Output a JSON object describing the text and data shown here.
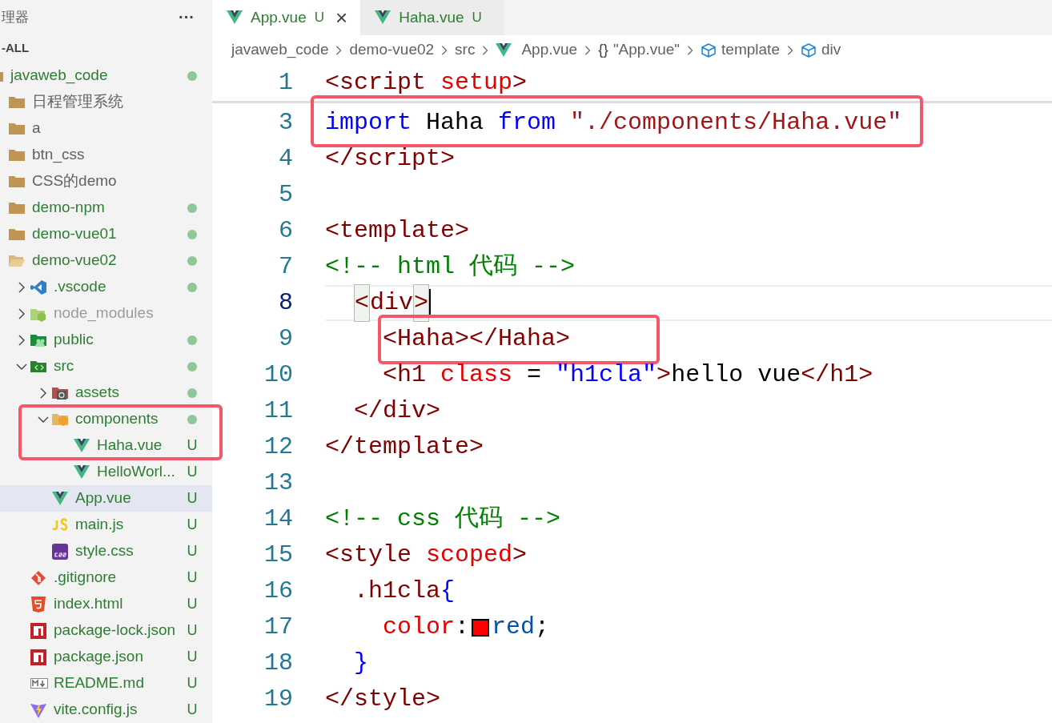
{
  "sidebar": {
    "title": "理器",
    "more": "···",
    "section": "-ALL",
    "tree": [
      {
        "label": "javaweb_code",
        "kind": "folder",
        "changed": true,
        "dimmed": false,
        "dot": true,
        "selected": false,
        "boxed": false,
        "children": [
          {
            "label": "日程管理系统",
            "kind": "folder",
            "changed": false,
            "dimmed": false,
            "dot": false,
            "selected": false,
            "boxed": false
          },
          {
            "label": "a",
            "kind": "folder",
            "changed": false,
            "dimmed": false,
            "dot": false,
            "selected": false,
            "boxed": false
          },
          {
            "label": "btn_css",
            "kind": "folder",
            "changed": false,
            "dimmed": false,
            "dot": false,
            "selected": false,
            "boxed": false
          },
          {
            "label": "CSS的demo",
            "kind": "folder",
            "changed": false,
            "dimmed": false,
            "dot": false,
            "selected": false,
            "boxed": false
          },
          {
            "label": "demo-npm",
            "kind": "folder",
            "changed": true,
            "dimmed": false,
            "dot": true,
            "selected": false,
            "boxed": false
          },
          {
            "label": "demo-vue01",
            "kind": "folder",
            "changed": true,
            "dimmed": false,
            "dot": true,
            "selected": false,
            "boxed": false
          },
          {
            "label": "demo-vue02",
            "kind": "folder-open",
            "changed": true,
            "dimmed": false,
            "dot": true,
            "selected": false,
            "boxed": false,
            "children": [
              {
                "label": ".vscode",
                "kind": "vscode",
                "changed": true,
                "dimmed": false,
                "dot": true,
                "expanded": false,
                "selected": false,
                "boxed": false
              },
              {
                "label": "node_modules",
                "kind": "node",
                "changed": false,
                "dimmed": true,
                "dot": false,
                "expanded": false,
                "selected": false,
                "boxed": false
              },
              {
                "label": "public",
                "kind": "public",
                "changed": true,
                "dimmed": false,
                "dot": true,
                "expanded": false,
                "selected": false,
                "boxed": false
              },
              {
                "label": "src",
                "kind": "src",
                "changed": true,
                "dimmed": false,
                "dot": true,
                "expanded": true,
                "selected": false,
                "boxed": false,
                "children": [
                  {
                    "label": "assets",
                    "kind": "assets",
                    "changed": true,
                    "dimmed": false,
                    "dot": true,
                    "expanded": false,
                    "selected": false,
                    "boxed": false
                  },
                  {
                    "label": "components",
                    "kind": "components",
                    "changed": true,
                    "dimmed": false,
                    "dot": true,
                    "expanded": true,
                    "selected": false,
                    "boxed": true,
                    "children": [
                      {
                        "label": "Haha.vue",
                        "kind": "vue",
                        "changed": true,
                        "dimmed": false,
                        "dot": false,
                        "badge": "U",
                        "selected": false,
                        "boxed": true
                      },
                      {
                        "label": "HelloWorl...",
                        "kind": "vue",
                        "changed": true,
                        "dimmed": false,
                        "dot": false,
                        "badge": "U",
                        "selected": false,
                        "boxed": false
                      }
                    ]
                  },
                  {
                    "label": "App.vue",
                    "kind": "vue",
                    "changed": true,
                    "dimmed": false,
                    "dot": false,
                    "badge": "U",
                    "selected": true,
                    "boxed": false
                  },
                  {
                    "label": "main.js",
                    "kind": "js",
                    "changed": true,
                    "dimmed": false,
                    "dot": false,
                    "badge": "U",
                    "selected": false,
                    "boxed": false
                  },
                  {
                    "label": "style.css",
                    "kind": "css",
                    "changed": true,
                    "dimmed": false,
                    "dot": false,
                    "badge": "U",
                    "selected": false,
                    "boxed": false
                  }
                ]
              },
              {
                "label": ".gitignore",
                "kind": "git",
                "changed": true,
                "dimmed": false,
                "dot": false,
                "badge": "U",
                "selected": false,
                "boxed": false
              },
              {
                "label": "index.html",
                "kind": "html",
                "changed": true,
                "dimmed": false,
                "dot": false,
                "badge": "U",
                "selected": false,
                "boxed": false
              },
              {
                "label": "package-lock.json",
                "kind": "npm",
                "changed": true,
                "dimmed": false,
                "dot": false,
                "badge": "U",
                "selected": false,
                "boxed": false
              },
              {
                "label": "package.json",
                "kind": "npm",
                "changed": true,
                "dimmed": false,
                "dot": false,
                "badge": "U",
                "selected": false,
                "boxed": false
              },
              {
                "label": "README.md",
                "kind": "md",
                "changed": true,
                "dimmed": false,
                "dot": false,
                "badge": "U",
                "selected": false,
                "boxed": false
              },
              {
                "label": "vite.config.js",
                "kind": "vite",
                "changed": true,
                "dimmed": false,
                "dot": false,
                "badge": "U",
                "selected": false,
                "boxed": false
              }
            ]
          }
        ]
      }
    ]
  },
  "tabs": [
    {
      "label": "App.vue",
      "badge": "U",
      "selected": true,
      "close": "×"
    },
    {
      "label": "Haha.vue",
      "badge": "U",
      "selected": false
    }
  ],
  "breadcrumb": [
    {
      "label": "javaweb_code",
      "kind": "text"
    },
    {
      "label": "demo-vue02",
      "kind": "text"
    },
    {
      "label": "src",
      "kind": "text"
    },
    {
      "label": "App.vue",
      "kind": "vue"
    },
    {
      "label": "\"App.vue\"",
      "kind": "braces",
      "icon_text": "{}"
    },
    {
      "label": "template",
      "kind": "cube"
    },
    {
      "label": "div",
      "kind": "cube"
    }
  ],
  "editor": {
    "lines": [
      {
        "number": "1",
        "sticky": true,
        "current": false,
        "cursor": false,
        "boxed": false,
        "tokens": [
          {
            "text": "<script",
            "kind": "tag"
          },
          {
            "text": " setup",
            "kind": "attr"
          },
          {
            "text": ">",
            "kind": "tag"
          }
        ]
      },
      {
        "number": "3",
        "sticky": false,
        "current": false,
        "cursor": false,
        "boxed": true,
        "tokens": [
          {
            "text": "import",
            "kind": "keyword"
          },
          {
            "text": " Haha ",
            "kind": "plain"
          },
          {
            "text": "from",
            "kind": "keyword"
          },
          {
            "text": " \"./components/Haha.vue\"",
            "kind": "string"
          }
        ]
      },
      {
        "number": "4",
        "sticky": false,
        "current": false,
        "cursor": false,
        "boxed": false,
        "tokens": [
          {
            "text": "</script>",
            "kind": "tag"
          }
        ]
      },
      {
        "number": "5",
        "sticky": false,
        "current": false,
        "cursor": false,
        "boxed": false
      },
      {
        "number": "6",
        "sticky": false,
        "current": false,
        "cursor": false,
        "boxed": false,
        "tokens": [
          {
            "text": "<template>",
            "kind": "tag"
          }
        ]
      },
      {
        "number": "7",
        "sticky": false,
        "current": false,
        "cursor": false,
        "boxed": false,
        "tokens": [
          {
            "text": "<!-- html 代码 -->",
            "kind": "comment"
          }
        ]
      },
      {
        "number": "8",
        "sticky": false,
        "current": true,
        "cursor": true,
        "boxed": false,
        "tokens": [
          {
            "text": "  <div>",
            "kind": "tag"
          }
        ]
      },
      {
        "number": "9",
        "sticky": false,
        "current": false,
        "cursor": false,
        "boxed": true,
        "tokens": [
          {
            "text": "    <Haha></Haha>",
            "kind": "tag"
          }
        ]
      },
      {
        "number": "10",
        "sticky": false,
        "current": false,
        "cursor": false,
        "boxed": false,
        "tokens": [
          {
            "text": "    <h1",
            "kind": "tag"
          },
          {
            "text": " class",
            "kind": "attr"
          },
          {
            "text": " = ",
            "kind": "plain"
          },
          {
            "text": "\"h1cla\"",
            "kind": "attrval"
          },
          {
            "text": ">",
            "kind": "tag"
          },
          {
            "text": "hello vue",
            "kind": "plain"
          },
          {
            "text": "</h1>",
            "kind": "tag"
          }
        ]
      },
      {
        "number": "11",
        "sticky": false,
        "current": false,
        "cursor": false,
        "boxed": false,
        "tokens": [
          {
            "text": "  </div>",
            "kind": "tag"
          }
        ]
      },
      {
        "number": "12",
        "sticky": false,
        "current": false,
        "cursor": false,
        "boxed": false,
        "tokens": [
          {
            "text": "</template>",
            "kind": "tag"
          }
        ]
      },
      {
        "number": "13",
        "sticky": false,
        "current": false,
        "cursor": false,
        "boxed": false
      },
      {
        "number": "14",
        "sticky": false,
        "current": false,
        "cursor": false,
        "boxed": false,
        "tokens": [
          {
            "text": "<!-- css 代码 -->",
            "kind": "comment"
          }
        ]
      },
      {
        "number": "15",
        "sticky": false,
        "current": false,
        "cursor": false,
        "boxed": false,
        "tokens": [
          {
            "text": "<style",
            "kind": "tag"
          },
          {
            "text": " scoped",
            "kind": "attr"
          },
          {
            "text": ">",
            "kind": "tag"
          }
        ]
      },
      {
        "number": "16",
        "sticky": false,
        "current": false,
        "cursor": false,
        "boxed": false,
        "tokens": [
          {
            "text": "  .h1cla",
            "kind": "selector"
          },
          {
            "text": "{",
            "kind": "brace"
          }
        ]
      },
      {
        "number": "17",
        "sticky": false,
        "current": false,
        "cursor": false,
        "boxed": false,
        "tokens": [
          {
            "text": "    color",
            "kind": "property"
          },
          {
            "text": ":",
            "kind": "plain"
          },
          {
            "kind": "swatch",
            "color": "#ff0000"
          },
          {
            "text": "red",
            "kind": "value"
          },
          {
            "text": ";",
            "kind": "plain"
          }
        ]
      },
      {
        "number": "18",
        "sticky": false,
        "current": false,
        "cursor": false,
        "boxed": false,
        "tokens": [
          {
            "text": "  }",
            "kind": "brace"
          }
        ]
      },
      {
        "number": "19",
        "sticky": false,
        "current": false,
        "cursor": false,
        "boxed": false,
        "tokens": [
          {
            "text": "</style>",
            "kind": "tag"
          }
        ]
      }
    ]
  }
}
